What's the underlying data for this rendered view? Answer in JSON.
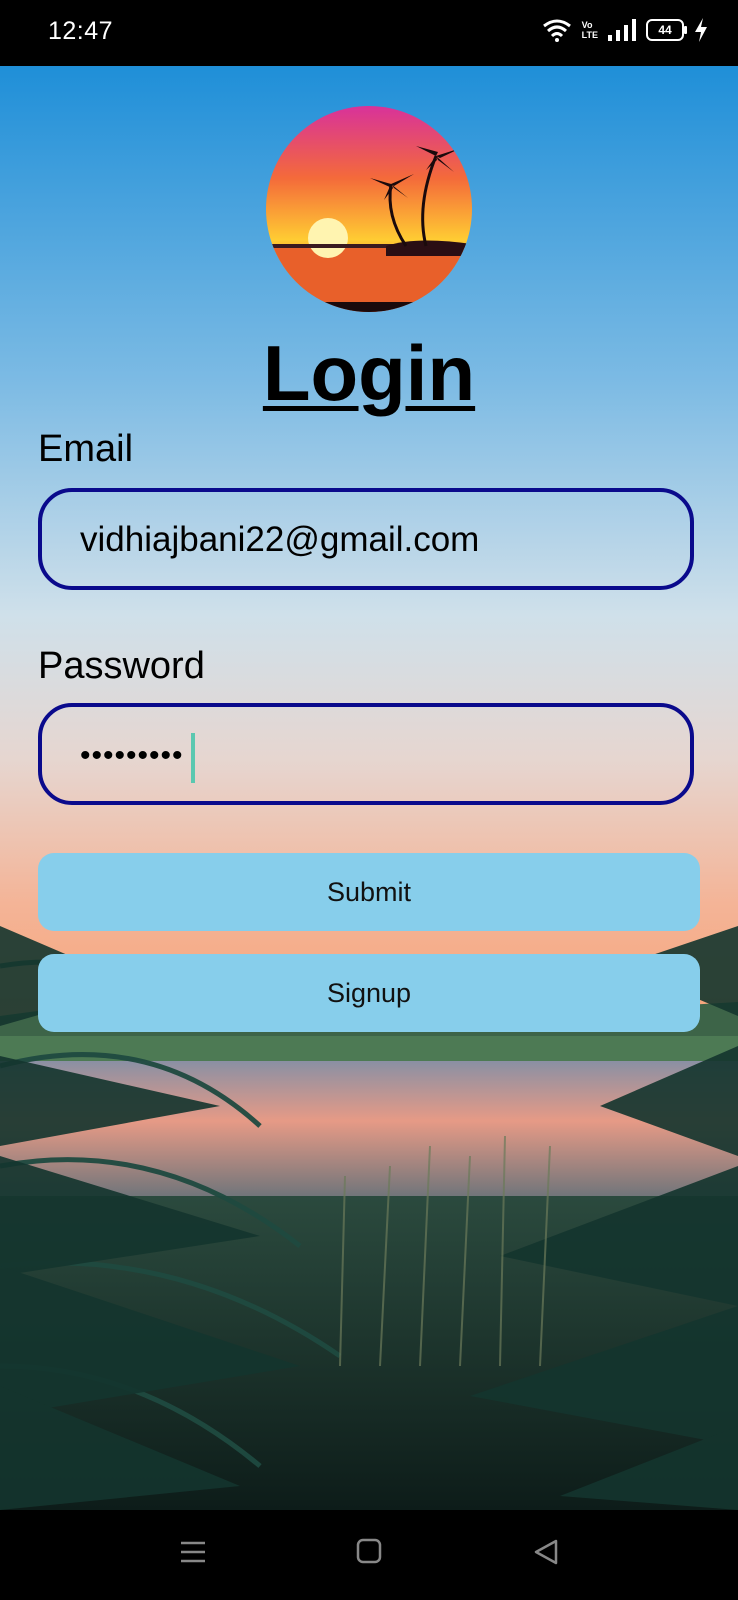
{
  "status_bar": {
    "time": "12:47",
    "volte_top": "Vo",
    "volte_bottom": "LTE",
    "battery": "44",
    "icons": [
      "wifi-icon",
      "volte-icon",
      "signal-icon",
      "battery-icon",
      "charging-icon"
    ]
  },
  "login": {
    "title": "Login",
    "email_label": "Email",
    "email_value": "vidhiajbani22@gmail.com",
    "password_label": "Password",
    "password_value": "•••••••••",
    "submit_label": "Submit",
    "signup_label": "Signup"
  },
  "nav_bar": {
    "icons": [
      "menu-icon",
      "home-icon",
      "back-icon"
    ]
  },
  "colors": {
    "field_border": "#0a0a8c",
    "button_bg": "#87ceeb",
    "caret": "#5ac8b0"
  }
}
